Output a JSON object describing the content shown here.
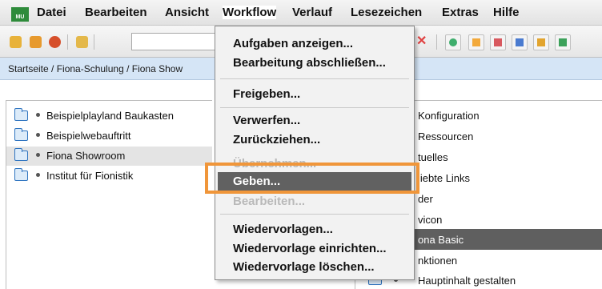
{
  "app": {
    "logo_text": "MU"
  },
  "menubar": {
    "items": [
      {
        "label": "Datei"
      },
      {
        "label": "Bearbeiten"
      },
      {
        "label": "Ansicht"
      },
      {
        "label": "Workflow"
      },
      {
        "label": "Verlauf"
      },
      {
        "label": "Lesezeichen"
      },
      {
        "label": "Extras"
      },
      {
        "label": "Hilfe"
      }
    ]
  },
  "toolbar": {
    "search_value": "",
    "icons": [
      "new-page-icon",
      "new-folder-icon",
      "globe-icon",
      "edit-check-icon",
      "delete-icon",
      "preview-icon",
      "layout-icon-1",
      "layout-icon-2",
      "layout-icon-3",
      "layout-icon-4",
      "layout-icon-5"
    ]
  },
  "breadcrumb": {
    "text": "Startseite / Fiona-Schulung / Fiona Show"
  },
  "left_tree": {
    "items": [
      {
        "label": "Beispielplayland Baukasten",
        "selected": false
      },
      {
        "label": "Beispielwebauftritt",
        "selected": false
      },
      {
        "label": "Fiona Showroom",
        "selected": true
      },
      {
        "label": "Institut für Fionistik",
        "selected": false
      }
    ]
  },
  "right_tree": {
    "items": [
      {
        "label": "Konfiguration"
      },
      {
        "label": "Ressourcen"
      },
      {
        "label": "tuelles"
      },
      {
        "label": "liebte Links"
      },
      {
        "label": "der"
      },
      {
        "label": "vicon"
      },
      {
        "label": "ona Basic",
        "selected": true
      },
      {
        "label": "nktionen"
      },
      {
        "label": "Hauptinhalt gestalten"
      }
    ]
  },
  "dropdown": {
    "items": [
      {
        "label": "Aufgaben anzeigen...",
        "state": "enabled"
      },
      {
        "label": "Bearbeitung abschließen...",
        "state": "enabled"
      },
      {
        "label": "Freigeben...",
        "state": "enabled"
      },
      {
        "label": "Verwerfen...",
        "state": "enabled"
      },
      {
        "label": "Zurückziehen...",
        "state": "enabled"
      },
      {
        "label": "Übernehmen...",
        "state": "disabled"
      },
      {
        "label": "Geben...",
        "state": "highlighted"
      },
      {
        "label": "Bearbeiten...",
        "state": "disabled"
      },
      {
        "label": "Wiedervorlagen...",
        "state": "enabled"
      },
      {
        "label": "Wiedervorlage einrichten...",
        "state": "enabled"
      },
      {
        "label": "Wiedervorlage löschen...",
        "state": "enabled"
      }
    ]
  },
  "colors": {
    "highlight": "#616161",
    "callout": "#f0963a",
    "breadcrumb_bg": "#d5e5f6",
    "logo": "#2e8b3a"
  }
}
